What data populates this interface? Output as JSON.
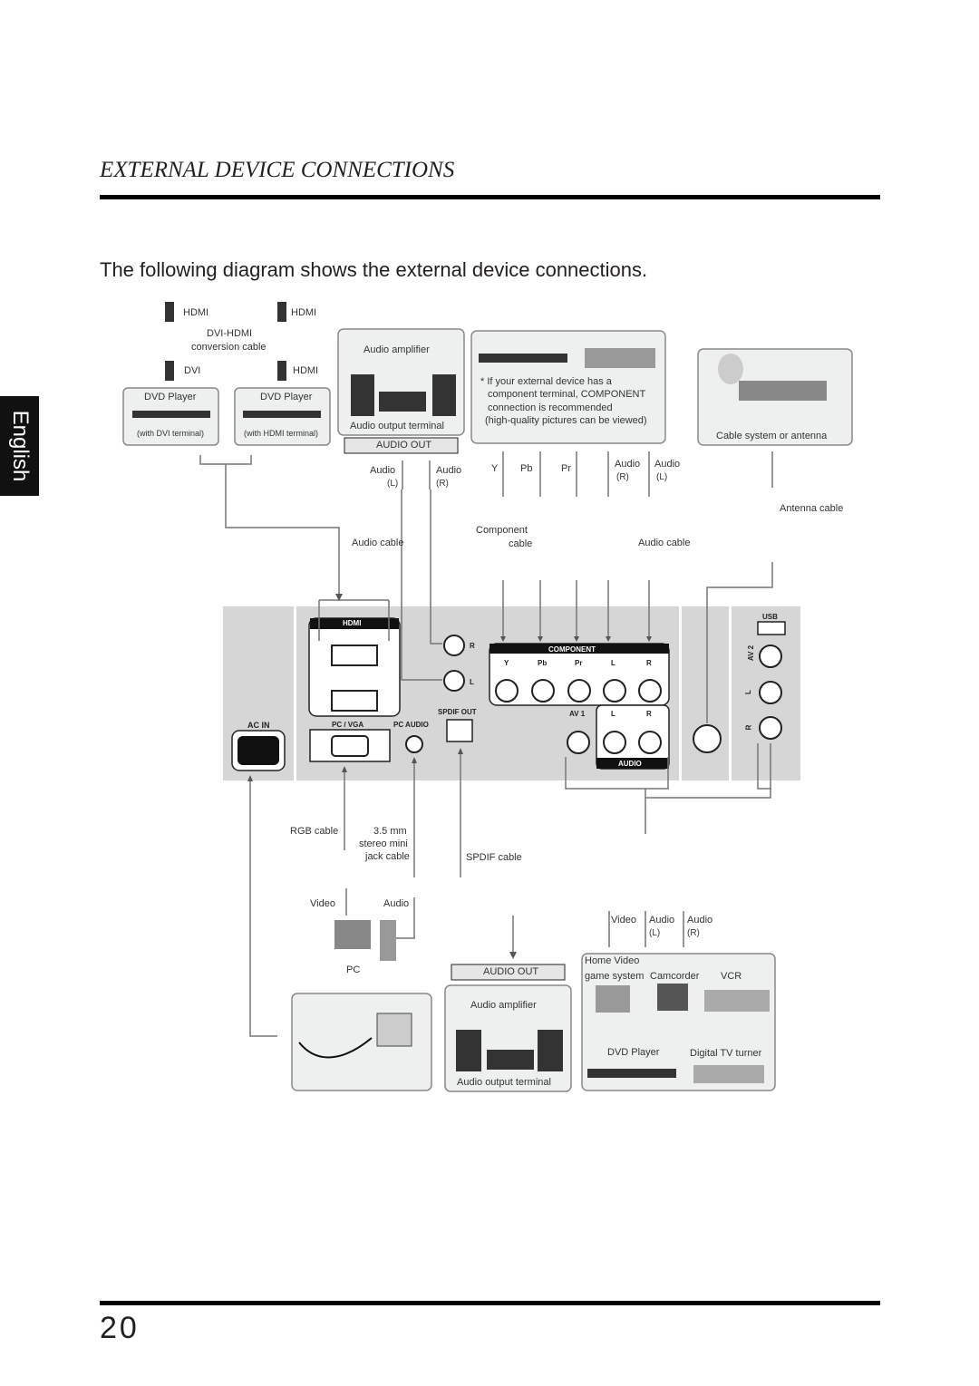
{
  "header": {
    "title": "EXTERNAL DEVICE CONNECTIONS",
    "subtitle": "The following diagram shows the external device connections.",
    "language_tab": "English"
  },
  "footer": {
    "page_number": "20"
  },
  "diagram": {
    "top_left": {
      "hdmi_a": "HDMI",
      "hdmi_b": "HDMI",
      "dvi_hdmi": "DVI-HDMI",
      "conversion": "conversion cable",
      "dvi": "DVI",
      "hdmi_c": "HDMI",
      "dvd1": "DVD Player",
      "dvd1_note": "(with DVI terminal)",
      "dvd2": "DVD Player",
      "dvd2_note": "(with HDMI terminal)"
    },
    "amp_top": {
      "title": "Audio amplifier",
      "terminal": "Audio output terminal",
      "audio_out": "AUDIO OUT",
      "audio_l": "Audio",
      "l": "(L)",
      "audio_r": "Audio",
      "r": "(R)",
      "cable": "Audio cable"
    },
    "component_box": {
      "note": [
        "* If your external device has a",
        "component terminal, COMPONENT",
        "connection is recommended",
        "(high-quality pictures can be viewed)"
      ],
      "y": "Y",
      "pb": "Pb",
      "pr": "Pr",
      "audio_r": "Audio",
      "r": "(R)",
      "audio_l": "Audio",
      "l": "(L)",
      "component_cable_1": "Component",
      "component_cable_2": "cable",
      "audio_cable": "Audio cable"
    },
    "antenna": {
      "box_label": "Cable system or antenna",
      "cable": "Antenna cable"
    },
    "panel": {
      "hdmi": "HDMI",
      "r": "R",
      "l": "L",
      "component": "COMPONENT",
      "y": "Y",
      "pb": "Pb",
      "pr": "Pr",
      "cl": "L",
      "cr": "R",
      "av1": "AV 1",
      "al": "L",
      "ar": "R",
      "audio": "AUDIO",
      "spdif_out": "SPDIF OUT",
      "ac_in": "AC IN",
      "pc_vga": "PC / VGA",
      "pc_audio": "PC AUDIO",
      "usb": "USB",
      "av2": "AV 2",
      "av2_l": "L",
      "av2_r": "R"
    },
    "pc": {
      "rgb_cable": "RGB cable",
      "mm": "3.5 mm",
      "stereo": "stereo mini",
      "jack": "jack cable",
      "video": "Video",
      "audio": "Audio",
      "pc": "PC"
    },
    "spdif": {
      "cable": "SPDIF cable",
      "audio_out": "AUDIO OUT",
      "amp": "Audio amplifier",
      "terminal": "Audio output terminal"
    },
    "av_devices": {
      "video": "Video",
      "audio_l": "Audio",
      "l": "(L)",
      "audio_r": "Audio",
      "r": "(R)",
      "home_video": "Home Video",
      "game_system": "game system",
      "camcorder": "Camcorder",
      "vcr": "VCR",
      "dvd": "DVD Player",
      "digital_tv": "Digital TV turner"
    }
  }
}
